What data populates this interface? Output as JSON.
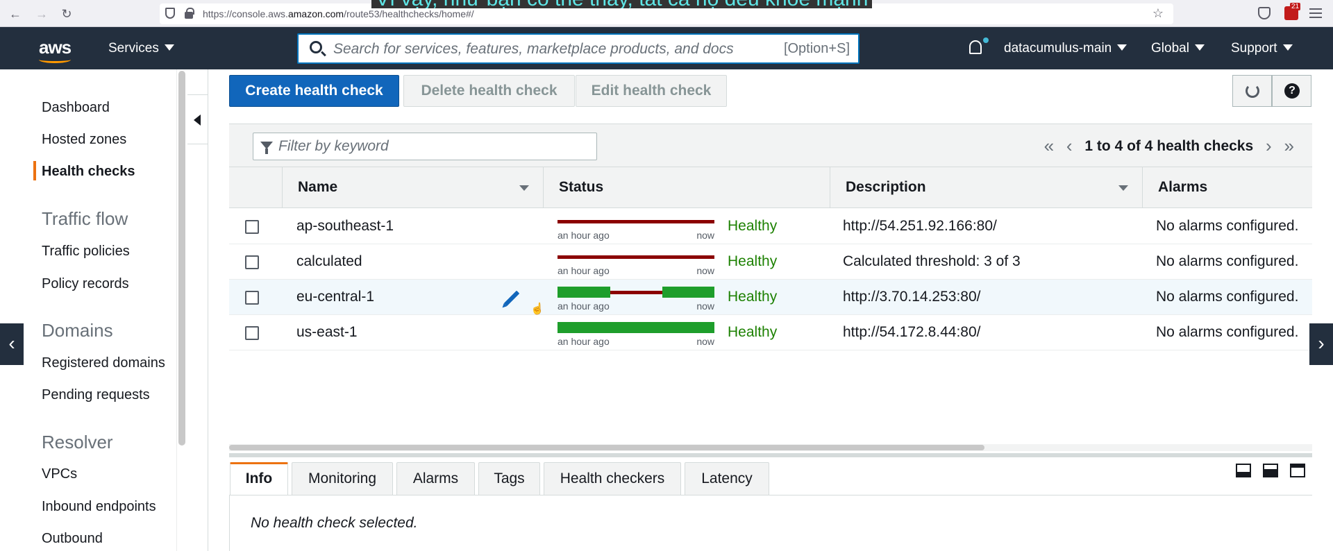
{
  "browser": {
    "url_prefix": "https://console.aws.",
    "url_domain": "amazon.com",
    "url_path": "/route53/healthchecks/home#/",
    "subtitle_overlay": "Vì vậy, như bạn có thể thấy, tất cả họ đều khỏe mạnh",
    "extension_badge": "21"
  },
  "topbar": {
    "services_label": "Services",
    "search_placeholder": "Search for services, features, marketplace products, and docs",
    "search_shortcut": "[Option+S]",
    "account_label": "datacumulus-main",
    "region_label": "Global",
    "support_label": "Support"
  },
  "sidebar": {
    "dashboard": "Dashboard",
    "hosted_zones": "Hosted zones",
    "health_checks": "Health checks",
    "traffic_flow_heading": "Traffic flow",
    "traffic_policies": "Traffic policies",
    "policy_records": "Policy records",
    "domains_heading": "Domains",
    "registered_domains": "Registered domains",
    "pending_requests": "Pending requests",
    "resolver_heading": "Resolver",
    "vpcs": "VPCs",
    "inbound_endpoints": "Inbound endpoints",
    "outbound": "Outbound"
  },
  "toolbar": {
    "create_label": "Create health check",
    "delete_label": "Delete health check",
    "edit_label": "Edit health check"
  },
  "table": {
    "filter_placeholder": "Filter by keyword",
    "pager_text": "1 to 4 of 4 health checks",
    "col_name": "Name",
    "col_status": "Status",
    "col_description": "Description",
    "col_alarms": "Alarms",
    "spark_left_label": "an hour ago",
    "spark_right_label": "now",
    "rows": [
      {
        "name": "ap-southeast-1",
        "status": "Healthy",
        "description": "http://54.251.92.166:80/",
        "alarms": "No alarms configured."
      },
      {
        "name": "calculated",
        "status": "Healthy",
        "description": "Calculated threshold: 3 of 3",
        "alarms": "No alarms configured."
      },
      {
        "name": "eu-central-1",
        "status": "Healthy",
        "description": "http://3.70.14.253:80/",
        "alarms": "No alarms configured."
      },
      {
        "name": "us-east-1",
        "status": "Healthy",
        "description": "http://54.172.8.44:80/",
        "alarms": "No alarms configured."
      }
    ]
  },
  "details": {
    "tabs": [
      "Info",
      "Monitoring",
      "Alarms",
      "Tags",
      "Health checkers",
      "Latency"
    ],
    "empty_message": "No health check selected."
  },
  "colors": {
    "aws_navy": "#232f3e",
    "primary_blue": "#1166bb",
    "healthy_green": "#1d8102",
    "unhealthy_red": "#8b0000",
    "accent_orange": "#ec7211"
  }
}
